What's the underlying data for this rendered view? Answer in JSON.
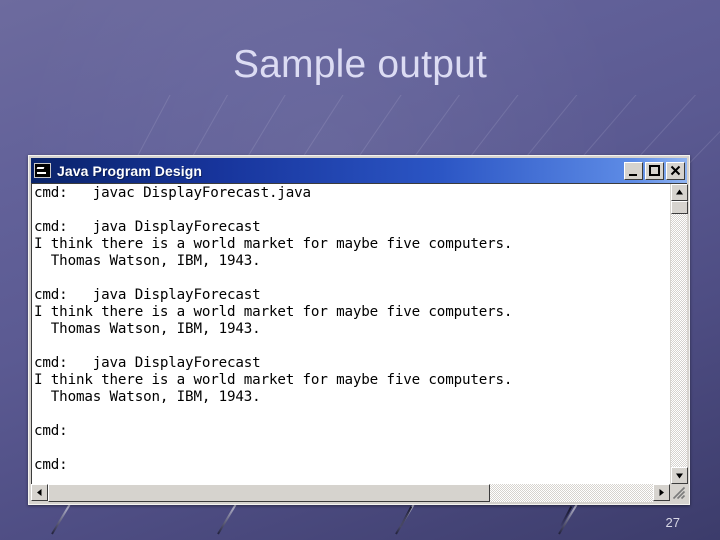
{
  "slide": {
    "title": "Sample output",
    "page_number": "27",
    "background_color": "#55548a",
    "title_color": "#dcdcf3"
  },
  "window": {
    "title": "Java Program Design",
    "icon": "console-icon",
    "titlebar_color": "#0a246a",
    "client_background": "#ffffff",
    "controls": {
      "minimize_label": "Minimize",
      "maximize_label": "Maximize",
      "close_label": "Close"
    },
    "console_lines": [
      "cmd:   javac DisplayForecast.java",
      "",
      "cmd:   java DisplayForecast",
      "I think there is a world market for maybe five computers.",
      "  Thomas Watson, IBM, 1943.",
      "",
      "cmd:   java DisplayForecast",
      "I think there is a world market for maybe five computers.",
      "  Thomas Watson, IBM, 1943.",
      "",
      "cmd:   java DisplayForecast",
      "I think there is a world market for maybe five computers.",
      "  Thomas Watson, IBM, 1943.",
      "",
      "cmd:",
      "",
      "cmd:"
    ],
    "scrollbars": {
      "vertical_up_label": "Scroll up",
      "vertical_down_label": "Scroll down",
      "horizontal_left_label": "Scroll left",
      "horizontal_right_label": "Scroll right",
      "horizontal_thumb_percent": "73",
      "vertical_thumb_percent": "5"
    }
  }
}
